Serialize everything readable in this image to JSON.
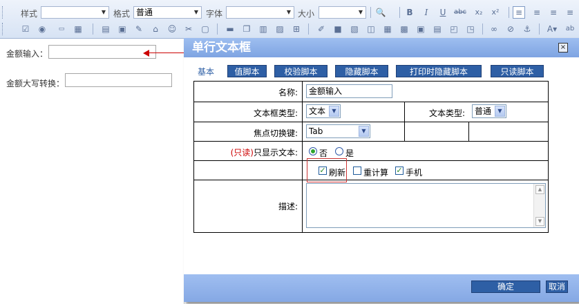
{
  "toolbar": {
    "style_label": "样式",
    "format_label": "格式",
    "format_value": "普通",
    "font_label": "字体",
    "size_label": "大小",
    "bold": "B",
    "italic": "I",
    "underline": "U",
    "strike": "abc",
    "subscript": "x₂",
    "superscript": "x²"
  },
  "form": {
    "amount_label": "金额输入：",
    "amount_upper_label": "金额大写转换："
  },
  "dialog": {
    "title": "单行文本框",
    "close": "×",
    "tabs": [
      {
        "label": "基本"
      },
      {
        "label": "值脚本"
      },
      {
        "label": "校验脚本"
      },
      {
        "label": "隐藏脚本"
      },
      {
        "label": "打印时隐藏脚本"
      },
      {
        "label": "只读脚本"
      }
    ],
    "name_label": "名称:",
    "name_value": "金额输入",
    "textbox_type_label": "文本框类型:",
    "textbox_type_value": "文本",
    "text_type_label": "文本类型:",
    "text_type_value": "普通",
    "focus_label": "焦点切换键:",
    "focus_value": "Tab",
    "readonly_prefix": "(只读)",
    "readonly_label": "只显示文本:",
    "radio_no": "否",
    "radio_yes": "是",
    "chk_refresh": "刷新",
    "chk_recalc": "重计算",
    "chk_mobile": "手机",
    "desc_label": "描述:",
    "ok": "确定",
    "cancel": "取消"
  },
  "colors": {
    "accent": "#2e5fa5",
    "title_bar": "#8aaee8",
    "readonly_red": "#cc0000"
  }
}
